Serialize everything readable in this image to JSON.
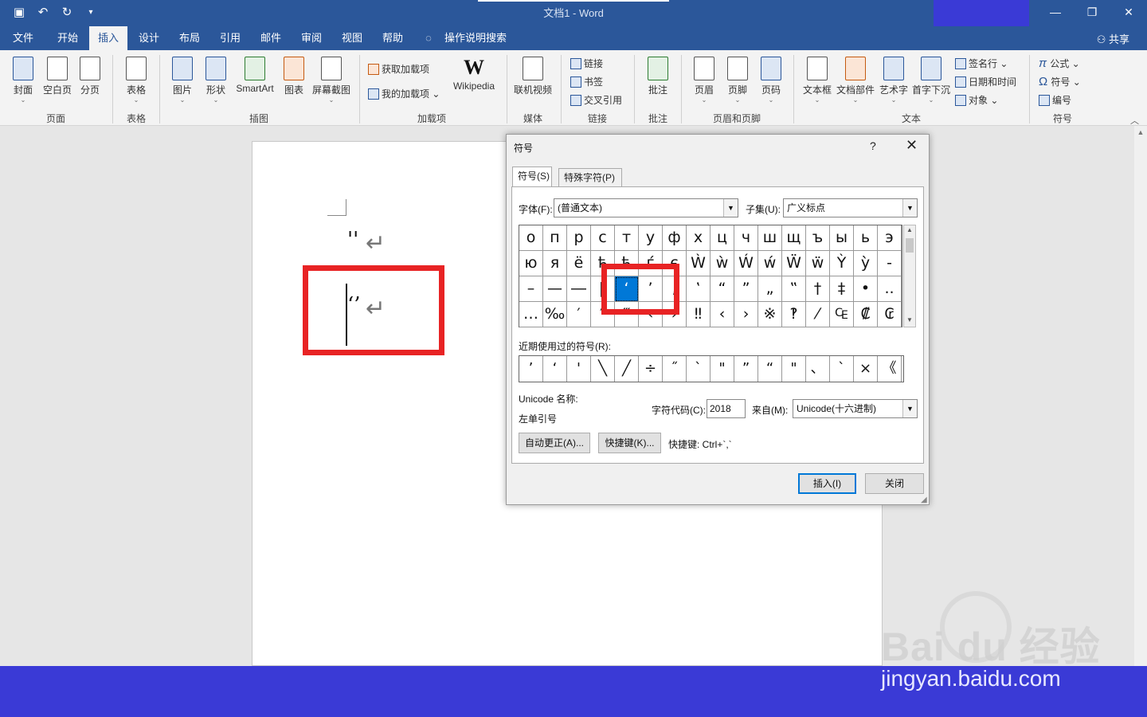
{
  "app": {
    "doc_title": "文档1  -  Word"
  },
  "menu": {
    "tabs": [
      {
        "label": "文件"
      },
      {
        "label": "开始"
      },
      {
        "label": "插入"
      },
      {
        "label": "设计"
      },
      {
        "label": "布局"
      },
      {
        "label": "引用"
      },
      {
        "label": "邮件"
      },
      {
        "label": "审阅"
      },
      {
        "label": "视图"
      },
      {
        "label": "帮助"
      },
      {
        "label": "操作说明搜索"
      }
    ],
    "active_tab": "插入",
    "share_label": "共享"
  },
  "ribbon": {
    "pages_group": {
      "label": "页面",
      "cover": "封面",
      "blank": "空白页",
      "break": "分页"
    },
    "table_group": {
      "label": "表格",
      "table": "表格"
    },
    "illus_group": {
      "label": "插图",
      "picture": "图片",
      "shapes": "形状",
      "smartart": "SmartArt",
      "chart": "图表",
      "screenshot": "屏幕截图"
    },
    "addins_group": {
      "label": "加载项",
      "get": "获取加载项",
      "mine": "我的加载项",
      "wikipedia": "Wikipedia",
      "wiki_glyph": "W"
    },
    "media_group": {
      "label": "媒体",
      "video": "联机视频"
    },
    "links_group": {
      "label": "链接",
      "link": "链接",
      "bookmark": "书签",
      "xref": "交叉引用"
    },
    "comments_group": {
      "label": "批注",
      "comment": "批注"
    },
    "hf_group": {
      "label": "页眉和页脚",
      "header": "页眉",
      "footer": "页脚",
      "pagenum": "页码"
    },
    "text_group": {
      "label": "文本",
      "textbox": "文本框",
      "parts": "文档部件",
      "wordart": "艺术字",
      "dropcap": "首字下沉",
      "sigline": "签名行",
      "datetime": "日期和时间",
      "object": "对象"
    },
    "symbols_group": {
      "label": "符号",
      "equation": "公式",
      "symbol": "符号",
      "number": "编号"
    }
  },
  "document": {
    "line1": "''",
    "line2": "‘’",
    "return_mark": "↵"
  },
  "dialog": {
    "title": "符号",
    "help": "?",
    "close": "✕",
    "tab_symbols": "符号(S)",
    "tab_special": "特殊字符(P)",
    "font_label": "字体(F):",
    "font_value": "(普通文本)",
    "subset_label": "子集(U):",
    "subset_value": "广义标点",
    "grid_rows": [
      [
        "о",
        "п",
        "р",
        "с",
        "т",
        "у",
        "ф",
        "х",
        "ц",
        "ч",
        "ш",
        "щ",
        "ъ",
        "ы",
        "ь",
        "э"
      ],
      [
        "ю",
        "я",
        "ё",
        "ђ",
        "ћ",
        "ѓ",
        "є",
        "Ẁ",
        "ẁ",
        "Ẃ",
        "ẃ",
        "Ẅ",
        "ẅ",
        "Ỳ",
        "ỳ",
        "‐"
      ],
      [
        "–",
        "—",
        "―",
        "‖",
        "‘",
        "’",
        "‚",
        "‛",
        "“",
        "”",
        "„",
        "‟",
        "†",
        "‡",
        "•",
        ".."
      ],
      [
        "…",
        "‰",
        "′",
        "″",
        "‴",
        "‹",
        "›",
        "‼",
        "‹",
        "›",
        "※",
        "‽",
        "⁄",
        "₠",
        "₡",
        "₢"
      ]
    ],
    "selected_symbol": "‘",
    "recent_label": "近期使用过的符号(R):",
    "recent": [
      "’",
      "‘",
      "'",
      "╲",
      "╱",
      "÷",
      "˝",
      "ˋ",
      "\"",
      "”",
      "“",
      "\"",
      "、",
      "`",
      "×",
      "《"
    ],
    "unicode_name_label": "Unicode 名称:",
    "unicode_name": "左单引号",
    "charcode_label": "字符代码(C):",
    "charcode_value": "2018",
    "from_label": "来自(M):",
    "from_value": "Unicode(十六进制)",
    "autocorrect": "自动更正(A)...",
    "shortcut_btn": "快捷键(K)...",
    "shortcut_text": "快捷键: Ctrl+`,`",
    "insert": "插入(I)",
    "cancel": "关闭"
  },
  "watermark": {
    "brand": "Bai du 经验",
    "url": "jingyan.baidu.com"
  }
}
